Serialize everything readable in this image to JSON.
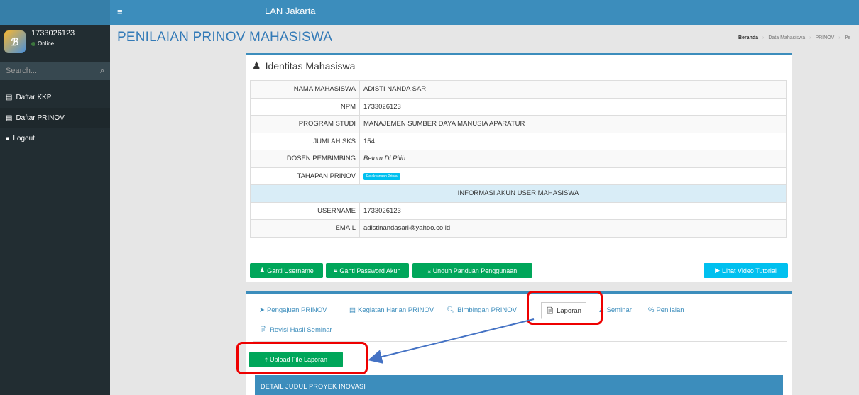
{
  "topbar": {
    "menu_icon": "hamburger-icon",
    "brand": "LAN Jakarta"
  },
  "sidebar": {
    "user_name": "1733026123",
    "user_status": "Online",
    "search_placeholder": "Search...",
    "items": [
      {
        "label": "Daftar KKP",
        "icon": "list-icon"
      },
      {
        "label": "Daftar PRINOV",
        "icon": "list-icon"
      },
      {
        "label": "Logout",
        "icon": "lock-icon"
      }
    ]
  },
  "header": {
    "title": "PENILAIAN PRINOV MAHASISWA",
    "breadcrumb": [
      "Beranda",
      "Data Mahasiswa",
      "PRINOV",
      "Pe"
    ]
  },
  "identity": {
    "title": "Identitas Mahasiswa",
    "rows": [
      {
        "label": "NAMA MAHASISWA",
        "value": "ADISTI NANDA SARI"
      },
      {
        "label": "NPM",
        "value": "1733026123"
      },
      {
        "label": "PROGRAM STUDI",
        "value": "MANAJEMEN SUMBER DAYA MANUSIA APARATUR"
      },
      {
        "label": "JUMLAH SKS",
        "value": "154"
      },
      {
        "label": "DOSEN PEMBIMBING",
        "value": "Belum Di Pilih"
      },
      {
        "label": "TAHAPAN PRINOV",
        "value": "Pelaksanaan Prinov"
      }
    ],
    "account_header": "INFORMASI AKUN USER MAHASISWA",
    "account_rows": [
      {
        "label": "USERNAME",
        "value": "1733026123"
      },
      {
        "label": "EMAIL",
        "value": "adistinandasari@yahoo.co.id"
      }
    ]
  },
  "buttons": {
    "ganti_username": "Ganti Username",
    "ganti_password": "Ganti Password Akun",
    "unduh_panduan": "Unduh Panduan Penggunaan",
    "lihat_video": "Lihat Video Tutorial"
  },
  "tabs": [
    {
      "label": "Pengajuan PRINOV",
      "icon": "paper-plane-icon"
    },
    {
      "label": "Kegiatan Harian PRINOV",
      "icon": "list-icon"
    },
    {
      "label": "Bimbingan PRINOV",
      "icon": "search-icon"
    },
    {
      "label": "Laporan",
      "icon": "file-icon",
      "active": true
    },
    {
      "label": "Seminar",
      "icon": "user-icon"
    },
    {
      "label": "Penilaian",
      "icon": "percent-icon"
    },
    {
      "label": "Revisi Hasil Seminar",
      "icon": "file-icon"
    }
  ],
  "upload_button": "Upload File Laporan",
  "detail_header": "DETAIL JUDUL PROYEK INOVASI",
  "colors": {
    "primary": "#3c8dbc",
    "success": "#00a65a",
    "info": "#00c0ef",
    "sidebar": "#222d32",
    "annotation": "#e00000"
  }
}
